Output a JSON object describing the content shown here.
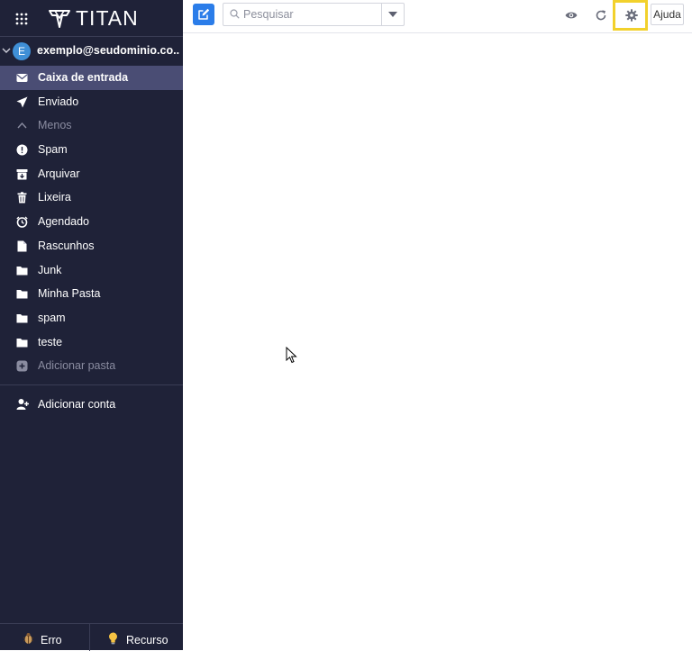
{
  "brand": {
    "logo_text": "TITAN"
  },
  "account": {
    "initial": "E",
    "email": "exemplo@seudominio.co..."
  },
  "folders": [
    {
      "label": "Caixa de entrada",
      "icon": "inbox-icon",
      "active": true
    },
    {
      "label": "Enviado",
      "icon": "send-icon"
    },
    {
      "label": "Menos",
      "icon": "chevron-up-icon",
      "muted": true
    },
    {
      "label": "Spam",
      "icon": "alert-circle-icon"
    },
    {
      "label": "Arquivar",
      "icon": "archive-icon"
    },
    {
      "label": "Lixeira",
      "icon": "trash-icon"
    },
    {
      "label": "Agendado",
      "icon": "clock-icon"
    },
    {
      "label": "Rascunhos",
      "icon": "draft-icon"
    },
    {
      "label": "Junk",
      "icon": "folder-icon"
    },
    {
      "label": "Minha Pasta",
      "icon": "folder-icon"
    },
    {
      "label": "spam",
      "icon": "folder-icon"
    },
    {
      "label": "teste",
      "icon": "folder-icon"
    },
    {
      "label": "Adicionar pasta",
      "icon": "add-folder-icon",
      "muted": true
    }
  ],
  "add_account": {
    "label": "Adicionar conta"
  },
  "bottom": {
    "erro_label": "Erro",
    "recurso_label": "Recurso"
  },
  "toolbar": {
    "search_placeholder": "Pesquisar",
    "help_label": "Ajuda",
    "highlight_color": "#f2d12c",
    "accent_color": "#2b7de9"
  }
}
